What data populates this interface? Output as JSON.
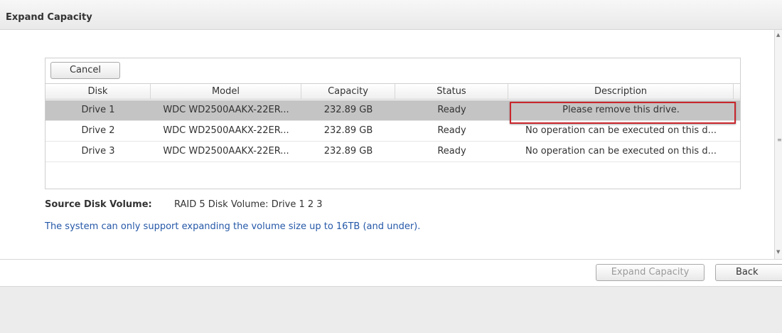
{
  "window": {
    "title": "Expand Capacity"
  },
  "toolbar": {
    "cancel_label": "Cancel"
  },
  "table": {
    "columns": {
      "disk": "Disk",
      "model": "Model",
      "capacity": "Capacity",
      "status": "Status",
      "description": "Description"
    },
    "rows": [
      {
        "disk": "Drive 1",
        "model": "WDC WD2500AAKX-22ER...",
        "capacity": "232.89 GB",
        "status": "Ready",
        "description": "Please remove this drive.",
        "selected": true
      },
      {
        "disk": "Drive 2",
        "model": "WDC WD2500AAKX-22ER...",
        "capacity": "232.89 GB",
        "status": "Ready",
        "description": "No operation can be executed on this d...",
        "selected": false
      },
      {
        "disk": "Drive 3",
        "model": "WDC WD2500AAKX-22ER...",
        "capacity": "232.89 GB",
        "status": "Ready",
        "description": "No operation can be executed on this d...",
        "selected": false
      }
    ]
  },
  "source": {
    "label": "Source Disk Volume:",
    "value": "RAID 5 Disk Volume: Drive 1 2 3"
  },
  "info": "The system can only support expanding the volume size up to 16TB (and under).",
  "buttons": {
    "expand_label": "Expand Capacity",
    "back_label": "Back"
  },
  "colors": {
    "highlight": "#c8262c",
    "info_text": "#2558a8",
    "selected_row": "#c4c4c4"
  }
}
